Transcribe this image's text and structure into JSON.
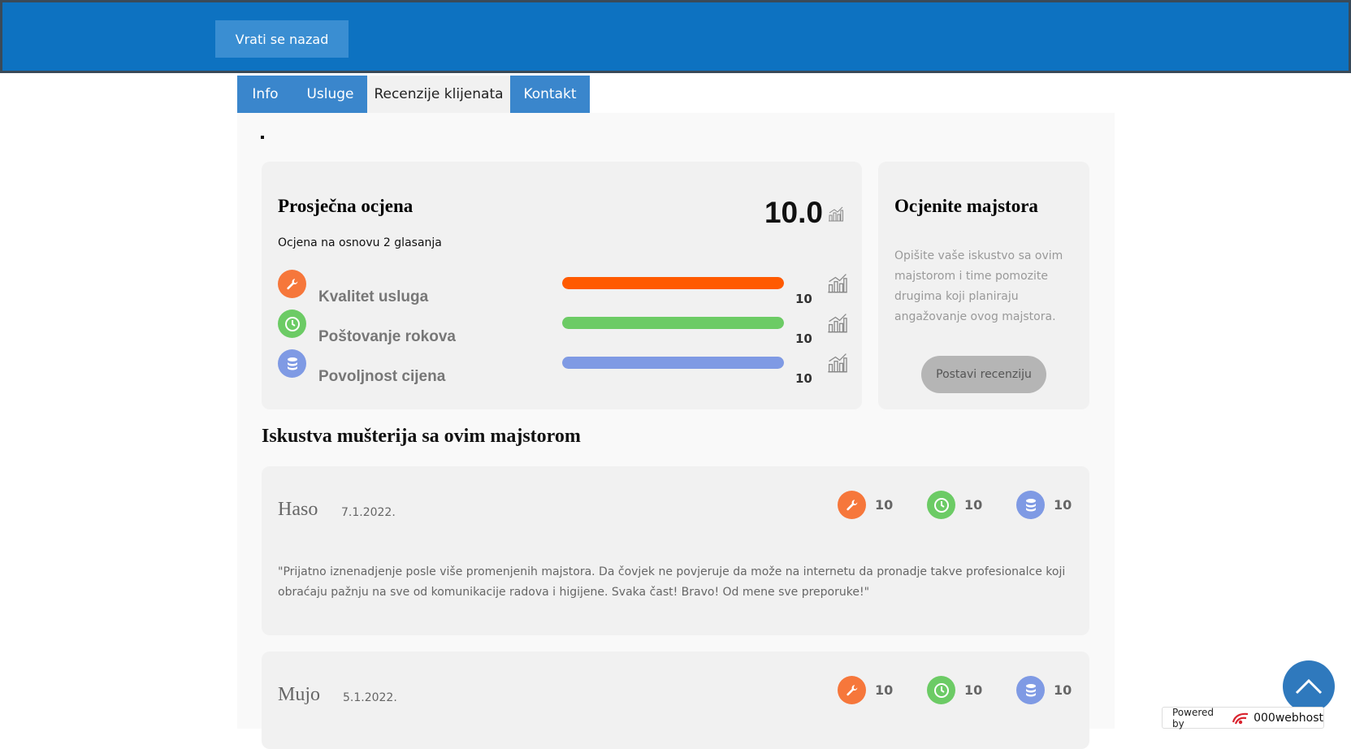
{
  "header": {
    "back_label": "Vrati se nazad"
  },
  "tabs": [
    {
      "label": "Info",
      "active": false
    },
    {
      "label": "Usluge",
      "active": false
    },
    {
      "label": "Recenzije klijenata",
      "active": true
    },
    {
      "label": "Kontakt",
      "active": false
    }
  ],
  "average": {
    "title": "Prosječna ocjena",
    "subtitle": "Ocjena na osnovu 2 glasanja",
    "score": "10.0",
    "criteria": [
      {
        "label": "Kvalitet usluga",
        "value": "10",
        "fraction": 1.0,
        "color": "#ff5a00",
        "icon": "wrench-icon"
      },
      {
        "label": "Poštovanje rokova",
        "value": "10",
        "fraction": 1.0,
        "color": "#6ccb65",
        "icon": "clock-icon"
      },
      {
        "label": "Povoljnost cijena",
        "value": "10",
        "fraction": 1.0,
        "color": "#7f9ae4",
        "icon": "coins-icon"
      }
    ]
  },
  "rate": {
    "title": "Ocjenite majstora",
    "description": "Opišite vaše iskustvo sa ovim majstorom i time pomozite drugima koji planiraju angažovanje ovog majstora.",
    "button_label": "Postavi recenziju"
  },
  "reviews_section": {
    "title": "Iskustva mušterija sa ovim majstorom",
    "items": [
      {
        "name": "Haso",
        "date": "7.1.2022.",
        "scores": [
          "10",
          "10",
          "10"
        ],
        "text": "\"Prijatno iznenadjenje posle više promenjenih majstora. Da čovjek ne povjeruje da može na internetu da pronadje takve profesionalce koji obraćaju pažnju na sve od komunikacije radova i higijene. Svaka čast! Bravo! Od mene sve preporuke!\""
      },
      {
        "name": "Mujo",
        "date": "5.1.2022.",
        "scores": [
          "10",
          "10",
          "10"
        ],
        "text": ""
      }
    ]
  },
  "footer": {
    "powered_label": "Powered by",
    "brand": "000webhost"
  },
  "colors": {
    "header_bg": "#0d72c1",
    "tab_bg": "#3a86cc",
    "orange": "#f6773b",
    "green": "#6ccb65",
    "blue": "#7f9ae4"
  }
}
